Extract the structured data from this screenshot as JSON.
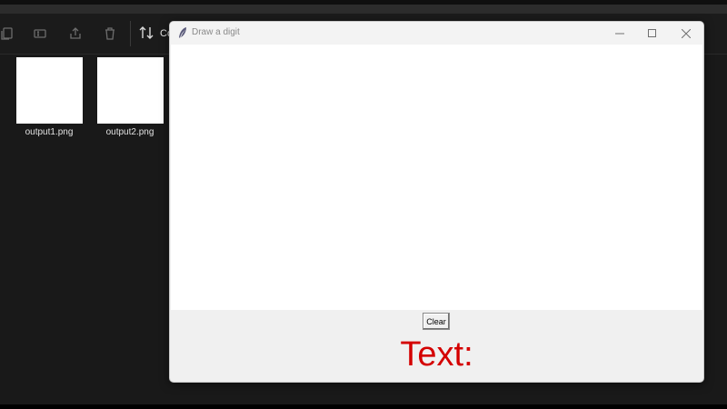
{
  "explorer": {
    "toolbar_icons": [
      "copy-icon",
      "rename-icon",
      "share-icon",
      "delete-icon"
    ],
    "sort": {
      "label": "Co",
      "icon": "sort-icon"
    },
    "files": [
      {
        "name": "output1.png"
      },
      {
        "name": "output2.png"
      }
    ]
  },
  "window": {
    "title": "Draw a digit",
    "icon": "feather-icon",
    "controls": [
      "minimize-icon",
      "maximize-icon",
      "close-icon"
    ],
    "clear_label": "Clear",
    "result_text": "Text:",
    "colors": {
      "result": "#d40000",
      "canvas": "#ffffff",
      "panel": "#f0f0f0"
    }
  }
}
